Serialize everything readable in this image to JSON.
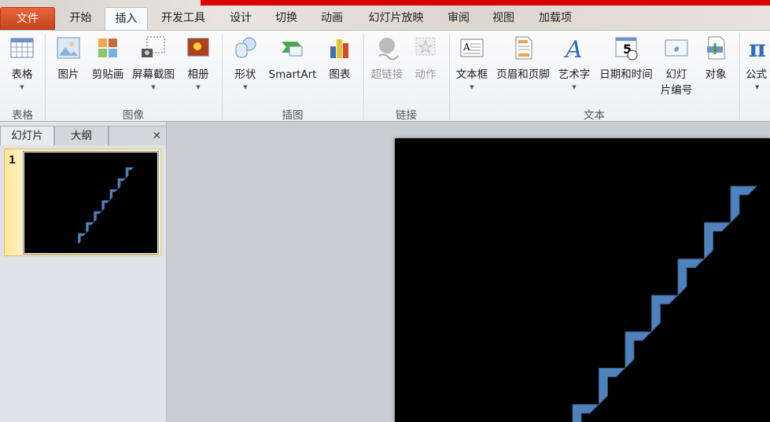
{
  "tabs": {
    "file": "文件",
    "home": "开始",
    "insert": "插入",
    "developer": "开发工具",
    "design": "设计",
    "transitions": "切换",
    "animations": "动画",
    "slideshow": "幻灯片放映",
    "review": "审阅",
    "view": "视图",
    "addins": "加载项"
  },
  "ribbon": {
    "table": {
      "label": "表格",
      "group": "表格"
    },
    "images": {
      "picture": "图片",
      "clipart": "剪贴画",
      "screenshot": "屏幕截图",
      "album": "相册",
      "group": "图像"
    },
    "illustrations": {
      "shapes": "形状",
      "smartart": "SmartArt",
      "chart": "图表",
      "group": "插图"
    },
    "links": {
      "hyperlink": "超链接",
      "action": "动作",
      "group": "链接"
    },
    "text": {
      "textbox": "文本框",
      "headerfooter": "页眉和页脚",
      "wordart": "艺术字",
      "datetime": "日期和时间",
      "slidenum1": "幻灯",
      "slidenum2": "片编号",
      "object": "对象",
      "group": "文本"
    },
    "symbols": {
      "equation": "公式"
    }
  },
  "panel": {
    "tab_slides": "幻灯片",
    "tab_outline": "大纲",
    "close": "✕",
    "slide_number": "1"
  },
  "slide": {
    "background": "#000000",
    "shape_color": "#4f81bd",
    "shape_outline": "#385d8a",
    "steps": 7
  },
  "colors": {
    "accent_red": "#d90000",
    "file_tab": "#d8532a"
  }
}
